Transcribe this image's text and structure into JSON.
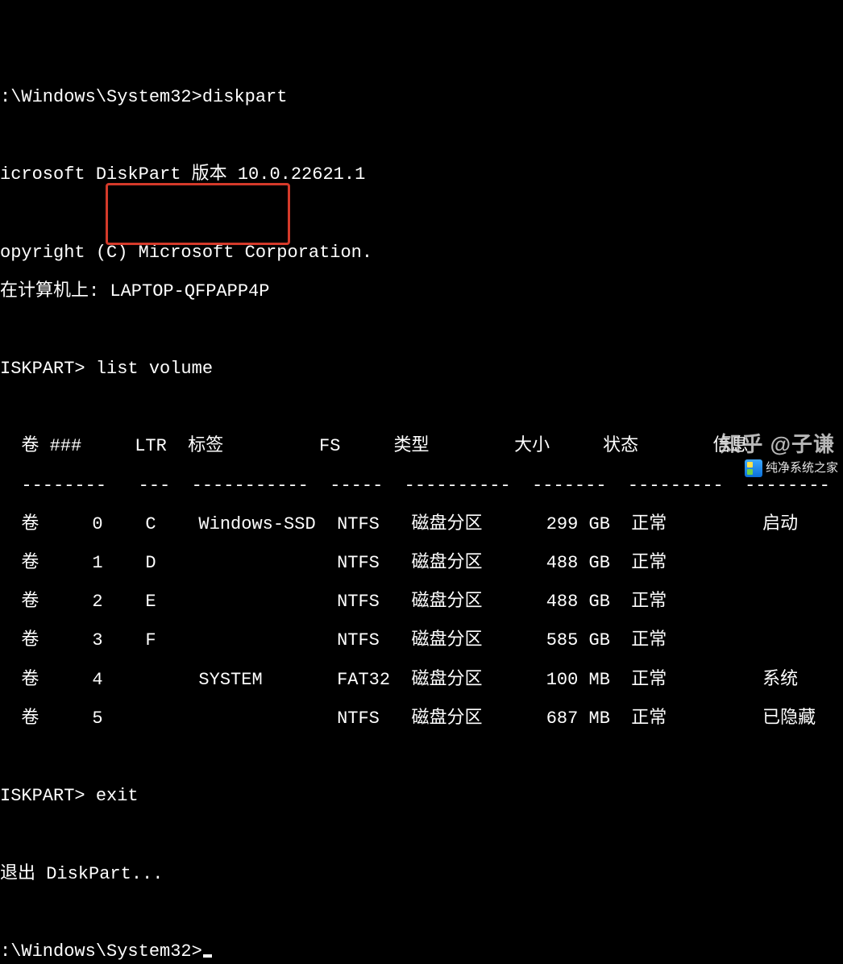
{
  "lines": {
    "prompt1": ":\\Windows\\System32>diskpart",
    "blank1": "",
    "version": "icrosoft DiskPart 版本 10.0.22621.1",
    "blank2": "",
    "copyright": "opyright (C) Microsoft Corporation.",
    "computer": "在计算机上: LAPTOP-QFPAPP4P",
    "blank3": "",
    "cmd_list": "ISKPART> list volume",
    "blank4": "",
    "header": "  卷 ###     LTR  标签         FS     类型        大小     状态       信息",
    "divider": "  --------   ---  -----------  -----  ----------  -------  ---------  --------",
    "row0": "  卷     0    C    Windows-SSD  NTFS   磁盘分区      299 GB  正常         启动",
    "row1": "  卷     1    D                 NTFS   磁盘分区      488 GB  正常",
    "row2": "  卷     2    E                 NTFS   磁盘分区      488 GB  正常",
    "row3": "  卷     3    F                 NTFS   磁盘分区      585 GB  正常",
    "row4": "  卷     4         SYSTEM       FAT32  磁盘分区      100 MB  正常         系统",
    "row5": "  卷     5                      NTFS   磁盘分区      687 MB  正常         已隐藏",
    "blank5": "",
    "cmd_exit": "ISKPART> exit",
    "blank6": "",
    "exiting": "退出 DiskPart...",
    "blank7": "",
    "prompt2": ":\\Windows\\System32>"
  },
  "chart_data": {
    "type": "table",
    "title": "list volume",
    "columns": [
      "卷 ###",
      "LTR",
      "标签",
      "FS",
      "类型",
      "大小",
      "状态",
      "信息"
    ],
    "rows": [
      {
        "vol": "卷     0",
        "ltr": "C",
        "label": "Windows-SSD",
        "fs": "NTFS",
        "type": "磁盘分区",
        "size": "299 GB",
        "status": "正常",
        "info": "启动"
      },
      {
        "vol": "卷     1",
        "ltr": "D",
        "label": "",
        "fs": "NTFS",
        "type": "磁盘分区",
        "size": "488 GB",
        "status": "正常",
        "info": ""
      },
      {
        "vol": "卷     2",
        "ltr": "E",
        "label": "",
        "fs": "NTFS",
        "type": "磁盘分区",
        "size": "488 GB",
        "status": "正常",
        "info": ""
      },
      {
        "vol": "卷     3",
        "ltr": "F",
        "label": "",
        "fs": "NTFS",
        "type": "磁盘分区",
        "size": "585 GB",
        "status": "正常",
        "info": ""
      },
      {
        "vol": "卷     4",
        "ltr": "",
        "label": "SYSTEM",
        "fs": "FAT32",
        "type": "磁盘分区",
        "size": "100 MB",
        "status": "正常",
        "info": "系统"
      },
      {
        "vol": "卷     5",
        "ltr": "",
        "label": "",
        "fs": "NTFS",
        "type": "磁盘分区",
        "size": "687 MB",
        "status": "正常",
        "info": "已隐藏"
      }
    ]
  },
  "watermarks": {
    "zhihu": "知乎 @子谦",
    "site": "纯净系统之家"
  }
}
